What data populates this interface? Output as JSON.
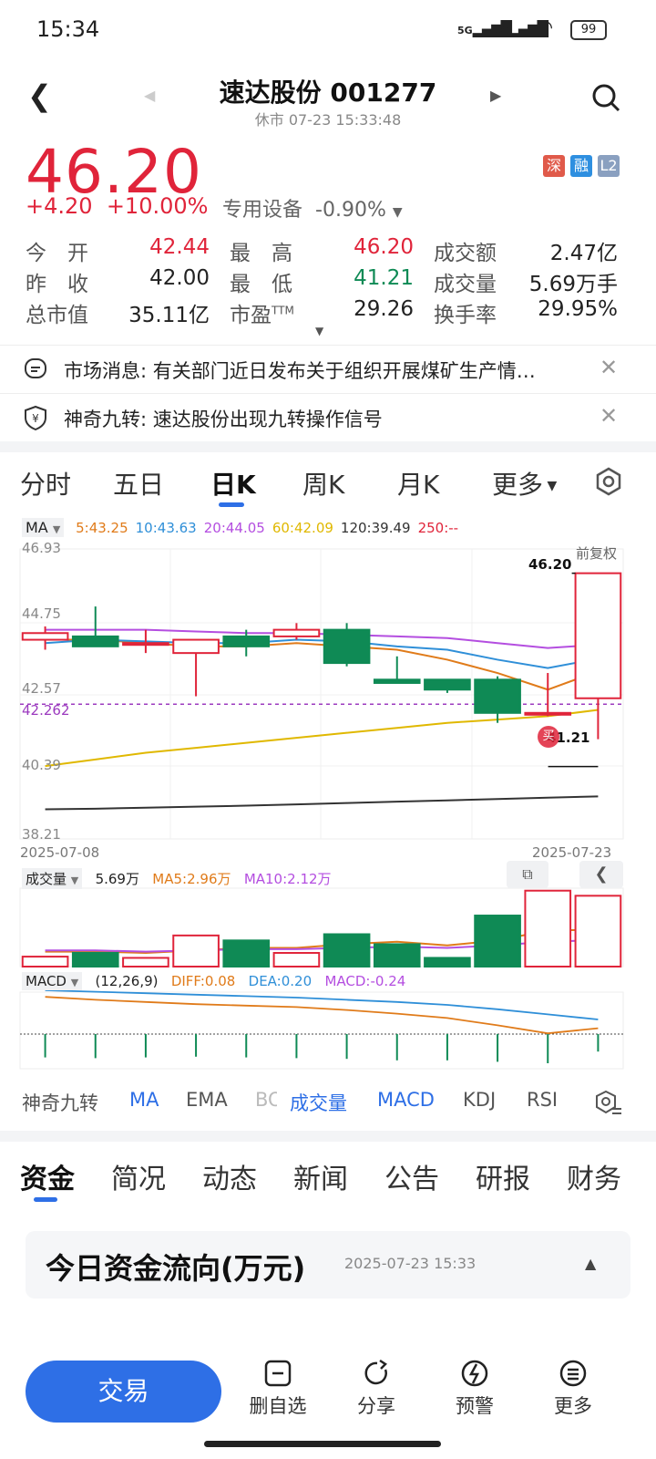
{
  "status_bar": {
    "time": "15:34",
    "signal1": "5G",
    "signal2": "5G",
    "battery": "99"
  },
  "header": {
    "title": "速达股份 001277",
    "subtitle": "休市 07-23 15:33:48"
  },
  "quote": {
    "price": "46.20",
    "change": "+4.20",
    "change_pct": "+10.00%",
    "sector": "专用设备",
    "sector_pct": "-0.90%",
    "badges": [
      "深",
      "融",
      "L2"
    ],
    "rows": [
      {
        "l1": "今　开",
        "v1": "42.44",
        "l2": "最　高",
        "v2": "46.20",
        "l3": "成交额",
        "v3": "2.47亿"
      },
      {
        "l1": "昨　收",
        "v1": "42.00",
        "l2": "最　低",
        "v2": "41.21",
        "l3": "成交量",
        "v3": "5.69万手"
      },
      {
        "l1": "总市值",
        "v1": "35.11亿",
        "l2": "市盈",
        "l2sup": "TTM",
        "v2": "29.26",
        "l3": "换手率",
        "v3": "29.95%"
      }
    ]
  },
  "messages": [
    {
      "label": "市场消息: 有关部门近日发布关于组织开展煤矿生产情…"
    },
    {
      "label": "神奇九转: 速达股份出现九转操作信号"
    }
  ],
  "chart_tabs": [
    "分时",
    "五日",
    "日K",
    "周K",
    "月K",
    "更多"
  ],
  "chart_tab_active": "日K",
  "ma_legend": {
    "label": "MA",
    "items": [
      {
        "text": "5:43.25",
        "color": "#e07b1a"
      },
      {
        "text": "10:43.63",
        "color": "#2f8fd8"
      },
      {
        "text": "20:44.05",
        "color": "#b44ee0"
      },
      {
        "text": "60:42.09",
        "color": "#e0b800"
      },
      {
        "text": "120:39.49",
        "color": "#333333"
      },
      {
        "text": "250:--",
        "color": "#e0243a"
      }
    ]
  },
  "chart_labels": {
    "y_top": "46.93",
    "y_2": "44.75",
    "y_3": "42.57",
    "y_4": "40.39",
    "y_bottom": "38.21",
    "ref_line": "42.262",
    "adj": "前复权",
    "high_label": "46.20",
    "low_label": "41.21",
    "buy_marker": "买",
    "date_start": "2025-07-08",
    "date_end": "2025-07-23"
  },
  "vol_legend": {
    "label": "成交量",
    "value": "5.69万",
    "ma5": "MA5:2.96万",
    "ma10": "MA10:2.12万"
  },
  "macd_legend": {
    "label": "MACD",
    "params": "(12,26,9)",
    "diff": "DIFF:0.08",
    "dea": "DEA:0.20",
    "macd": "MACD:-0.24"
  },
  "chart_data": [
    {
      "type": "candlestick",
      "x": [
        "2025-07-08",
        "2025-07-09",
        "2025-07-10",
        "2025-07-11",
        "2025-07-14",
        "2025-07-15",
        "2025-07-16",
        "2025-07-17",
        "2025-07-18",
        "2025-07-21",
        "2025-07-22",
        "2025-07-23"
      ],
      "ohlc": [
        [
          44.2,
          44.6,
          43.9,
          44.4
        ],
        [
          44.3,
          45.2,
          44.1,
          44.0
        ],
        [
          44.1,
          44.5,
          43.8,
          44.1
        ],
        [
          43.8,
          44.2,
          42.5,
          44.2
        ],
        [
          44.3,
          44.5,
          43.7,
          44.0
        ],
        [
          44.3,
          44.7,
          44.2,
          44.5
        ],
        [
          44.5,
          44.7,
          43.4,
          43.5
        ],
        [
          43.0,
          43.7,
          43.0,
          42.9
        ],
        [
          43.0,
          43.0,
          42.6,
          42.7
        ],
        [
          43.0,
          43.1,
          41.7,
          42.0
        ],
        [
          42.0,
          43.2,
          41.9,
          42.0
        ],
        [
          42.44,
          46.2,
          41.21,
          46.2
        ]
      ],
      "ma": {
        "MA5": [
          44.2,
          44.2,
          44.1,
          44.0,
          44.0,
          44.1,
          44.0,
          43.9,
          43.6,
          43.2,
          42.7,
          43.25
        ],
        "MA10": [
          44.1,
          44.2,
          44.15,
          44.1,
          44.1,
          44.2,
          44.15,
          44.0,
          43.9,
          43.6,
          43.35,
          43.63
        ],
        "MA20": [
          44.5,
          44.5,
          44.5,
          44.45,
          44.4,
          44.4,
          44.35,
          44.3,
          44.25,
          44.1,
          43.95,
          44.05
        ],
        "MA60": [
          40.4,
          40.6,
          40.8,
          40.95,
          41.1,
          41.25,
          41.4,
          41.55,
          41.7,
          41.8,
          41.9,
          42.09
        ],
        "MA120": [
          39.1,
          39.12,
          39.15,
          39.18,
          39.21,
          39.25,
          39.29,
          39.33,
          39.37,
          39.41,
          39.45,
          39.49
        ]
      },
      "ylim": [
        38.21,
        46.93
      ]
    },
    {
      "type": "bar",
      "name": "成交量",
      "values": [
        0.8,
        1.1,
        0.7,
        2.5,
        2.1,
        1.1,
        2.6,
        1.8,
        0.7,
        4.1,
        6.1,
        5.69
      ],
      "ma5": [
        1.2,
        1.2,
        1.1,
        1.3,
        1.5,
        1.5,
        1.8,
        2.0,
        1.7,
        2.1,
        2.9,
        2.96
      ],
      "ma10": [
        1.3,
        1.3,
        1.2,
        1.3,
        1.4,
        1.4,
        1.5,
        1.6,
        1.5,
        1.7,
        2.0,
        2.12
      ]
    },
    {
      "type": "bar",
      "name": "MACD",
      "values": [
        -0.32,
        -0.33,
        -0.32,
        -0.31,
        -0.32,
        -0.33,
        -0.34,
        -0.36,
        -0.36,
        -0.38,
        -0.4,
        -0.24
      ],
      "diff": [
        0.51,
        0.47,
        0.44,
        0.41,
        0.39,
        0.37,
        0.33,
        0.28,
        0.22,
        0.12,
        0.01,
        0.08
      ],
      "dea": [
        0.6,
        0.58,
        0.56,
        0.54,
        0.52,
        0.5,
        0.47,
        0.44,
        0.4,
        0.34,
        0.27,
        0.2
      ]
    }
  ],
  "indicators": [
    "神奇九转",
    "MA",
    "EMA",
    "BOLL",
    "成交量",
    "MACD",
    "KDJ",
    "RSI"
  ],
  "indicators_active": [
    "MA",
    "成交量",
    "MACD"
  ],
  "bottom_tabs": [
    "资金",
    "简况",
    "动态",
    "新闻",
    "公告",
    "研报",
    "财务"
  ],
  "bottom_tab_active": "资金",
  "fund_card": {
    "title": "今日资金流向(万元)",
    "time": "2025-07-23 15:33"
  },
  "actions": {
    "trade": "交易",
    "items": [
      {
        "icon": "minus-square-icon",
        "label": "删自选"
      },
      {
        "icon": "share-icon",
        "label": "分享"
      },
      {
        "icon": "alert-icon",
        "label": "预警"
      },
      {
        "icon": "more-icon",
        "label": "更多"
      }
    ]
  }
}
